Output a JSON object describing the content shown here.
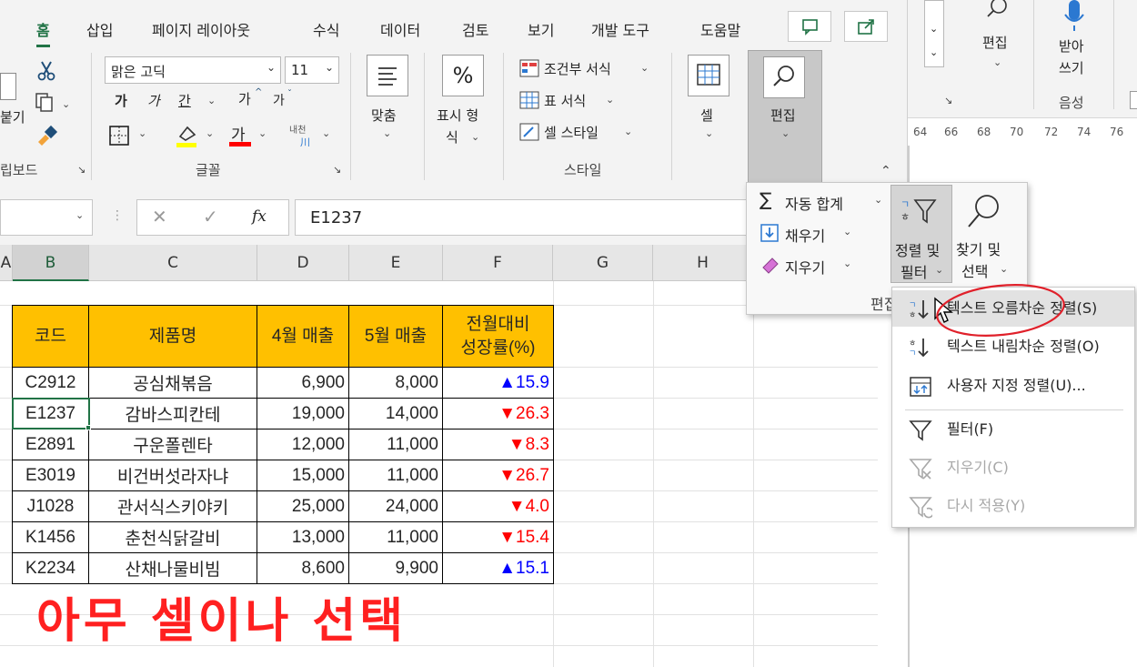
{
  "ribbon": {
    "tabs": [
      "홈",
      "삽입",
      "페이지 레이아웃",
      "수식",
      "데이터",
      "검토",
      "보기",
      "개발 도구",
      "도움말"
    ],
    "clipboard": {
      "paste_label": "붙기",
      "group_label": "립보드"
    },
    "font": {
      "name": "맑은 고딕",
      "size": "11",
      "bold": "가",
      "italic": "가",
      "underline": "간",
      "grow": "가",
      "shrink": "가",
      "fontcolor": "가",
      "phonetic_top": "내천",
      "phonetic_bottom": "川",
      "group_label": "글꼴"
    },
    "align": {
      "label": "맞춤"
    },
    "number": {
      "label_line1": "표시 형",
      "label_line2": "식",
      "symbol": "%"
    },
    "styles": {
      "conditional": "조건부 서식",
      "table_format": "표 서식",
      "cell_style": "셀 스타일",
      "group_label": "스타일"
    },
    "cells": {
      "label": "셀"
    },
    "editing": {
      "label": "편집"
    }
  },
  "formula_bar": {
    "fx": "fx",
    "content": "E1237"
  },
  "sheet": {
    "columns": [
      "A",
      "B",
      "C",
      "D",
      "E",
      "F",
      "G",
      "H"
    ],
    "headers": [
      "코드",
      "제품명",
      "4월 매출",
      "5월 매출",
      "전월대비",
      "성장률(%)"
    ],
    "rows": [
      {
        "code": "C2912",
        "name": "공심채볶음",
        "apr": "6,900",
        "may": "8,000",
        "dir": "▲",
        "rate": "15.9",
        "trend": "up"
      },
      {
        "code": "E1237",
        "name": "감바스피칸테",
        "apr": "19,000",
        "may": "14,000",
        "dir": "▼",
        "rate": "26.3",
        "trend": "down"
      },
      {
        "code": "E2891",
        "name": "구운폴렌타",
        "apr": "12,000",
        "may": "11,000",
        "dir": "▼",
        "rate": "8.3",
        "trend": "down"
      },
      {
        "code": "E3019",
        "name": "비건버섯라자냐",
        "apr": "15,000",
        "may": "11,000",
        "dir": "▼",
        "rate": "26.7",
        "trend": "down"
      },
      {
        "code": "J1028",
        "name": "관서식스키야키",
        "apr": "25,000",
        "may": "24,000",
        "dir": "▼",
        "rate": "4.0",
        "trend": "down"
      },
      {
        "code": "K1456",
        "name": "춘천식닭갈비",
        "apr": "13,000",
        "may": "11,000",
        "dir": "▼",
        "rate": "15.4",
        "trend": "down"
      },
      {
        "code": "K2234",
        "name": "산채나물비빔",
        "apr": "8,600",
        "may": "9,900",
        "dir": "▲",
        "rate": "15.1",
        "trend": "up"
      }
    ],
    "annotation": "아무 셀이나 선택"
  },
  "edit_dropdown": {
    "autosum": "자동 합계",
    "fill": "채우기",
    "clear": "지우기",
    "sort_filter_line1": "정렬 및",
    "sort_filter_line2": "필터",
    "find_line1": "찾기 및",
    "find_line2": "선택",
    "group_label": "편집"
  },
  "sort_menu": {
    "items": [
      {
        "label": "텍스트 오름차순 정렬(S)",
        "icon": "sort-ascending-icon"
      },
      {
        "label": "텍스트 내림차순 정렬(O)",
        "icon": "sort-descending-icon"
      },
      {
        "label": "사용자 지정 정렬(U)...",
        "icon": "custom-sort-icon"
      },
      {
        "label": "필터(F)",
        "icon": "filter-icon"
      },
      {
        "label": "지우기(C)",
        "icon": "clear-filter-icon"
      },
      {
        "label": "다시 적용(Y)",
        "icon": "reapply-filter-icon"
      }
    ]
  },
  "word": {
    "editing_label": "편집",
    "dictate_line1": "받아",
    "dictate_line2": "쓰기",
    "voice_label": "음성",
    "ruler": [
      "64",
      "66",
      "68",
      "70",
      "72",
      "74",
      "76"
    ]
  },
  "colors": {
    "accent": "#217346",
    "header_fill": "#ffc000",
    "up": "#0000ff",
    "down": "#ff0000",
    "annotation": "#ff2020"
  }
}
